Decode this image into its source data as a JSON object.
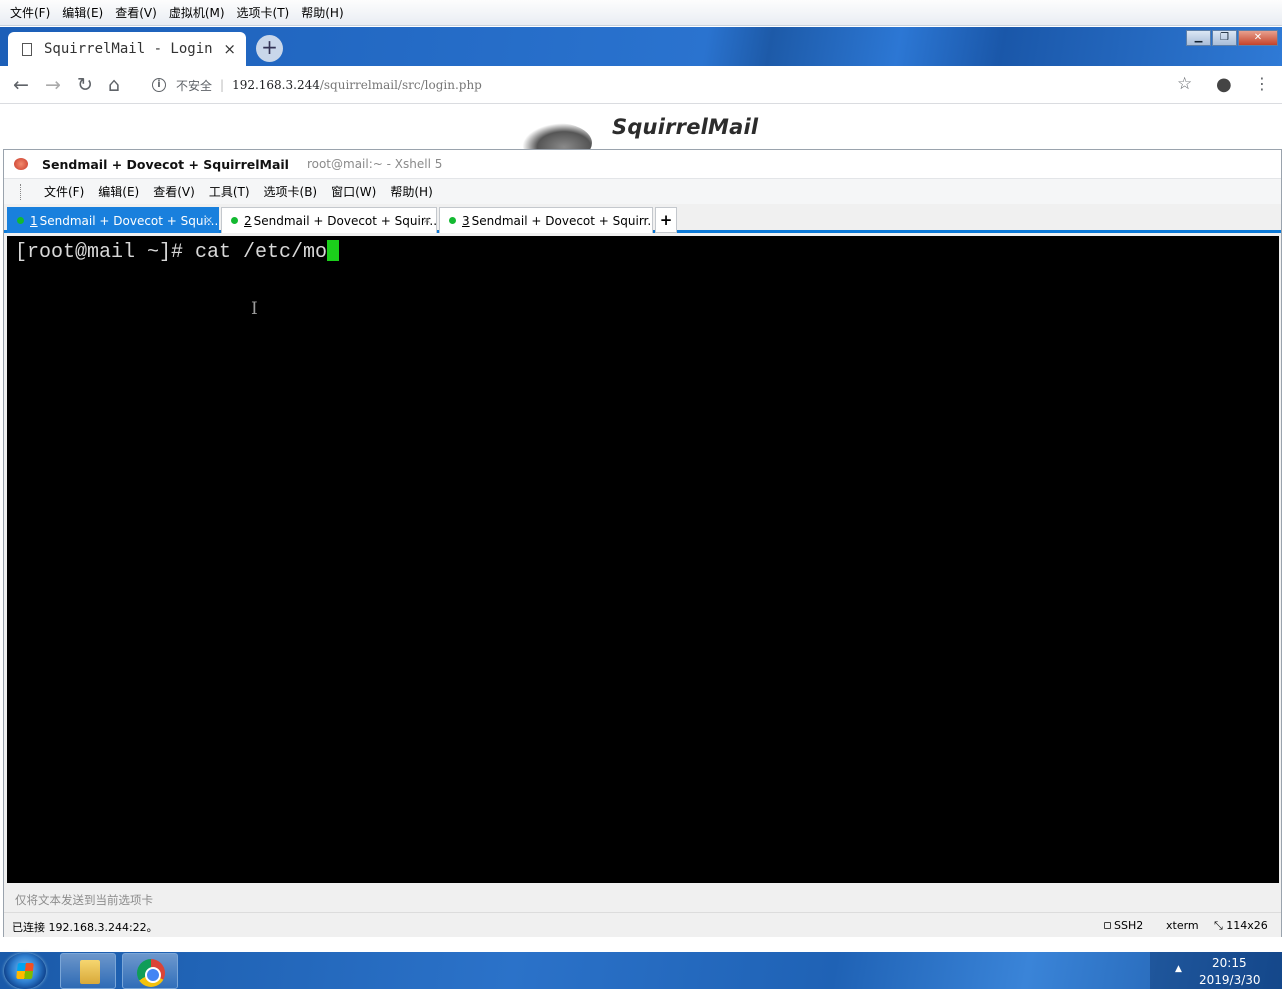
{
  "vm_menu": [
    "文件(F)",
    "编辑(E)",
    "查看(V)",
    "虚拟机(M)",
    "选项卡(T)",
    "帮助(H)"
  ],
  "browser": {
    "tab_title": "SquirrelMail - Login",
    "tab_close": "×",
    "new_tab": "+",
    "security_label": "不安全",
    "url_host": "192.168.3.244",
    "url_path": "/squirrelmail/src/login.php",
    "icons": [
      "back-icon",
      "forward-icon",
      "reload-icon",
      "home-icon",
      "info-icon",
      "star-icon",
      "account-icon",
      "menu-icon"
    ]
  },
  "page": {
    "logo_text": "SquirrelMail"
  },
  "xshell": {
    "title_bold": "Sendmail + Dovecot + SquirrelMail",
    "title_sub": "root@mail:~ - Xshell 5",
    "menu": [
      "文件(F)",
      "编辑(E)",
      "查看(V)",
      "工具(T)",
      "选项卡(B)",
      "窗口(W)",
      "帮助(H)"
    ],
    "tabs": [
      {
        "num": "1",
        "label": " Sendmail + Dovecot + Squi...",
        "active": true
      },
      {
        "num": "2",
        "label": " Sendmail + Dovecot + Squirr...",
        "active": false
      },
      {
        "num": "3",
        "label": " Sendmail + Dovecot + Squirr...",
        "active": false
      }
    ],
    "add_tab": "+",
    "terminal_text": "[root@mail ~]# cat /etc/mo",
    "compose_placeholder": "仅将文本发送到当前选项卡",
    "status": {
      "connection": "已连接 192.168.3.244:22。",
      "protocol": "SSH2",
      "terminal_type": "xterm",
      "size": "114x26"
    }
  },
  "taskbar": {
    "time": "20:15",
    "date": "2019/3/30"
  }
}
